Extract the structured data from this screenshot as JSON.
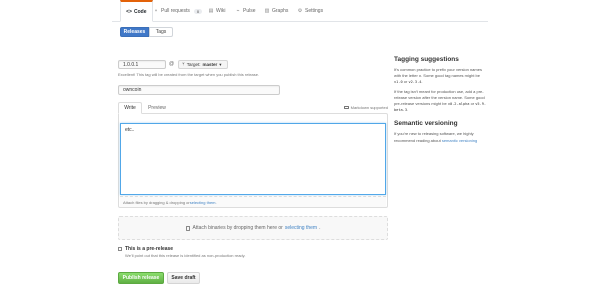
{
  "repo_nav": {
    "tabs": [
      {
        "label": "Code",
        "icon": "code-icon"
      },
      {
        "label": "Pull requests",
        "icon": "pull-request-icon",
        "count": "0"
      },
      {
        "label": "Wiki",
        "icon": "book-icon"
      },
      {
        "label": "Pulse",
        "icon": "pulse-icon"
      },
      {
        "label": "Graphs",
        "icon": "graph-icon"
      },
      {
        "label": "Settings",
        "icon": "gear-icon"
      }
    ]
  },
  "subnav": {
    "releases": "Releases",
    "tags": "Tags"
  },
  "form": {
    "tag_value": "1.0.0.1",
    "at": "@",
    "target_prefix": "Target:",
    "target_branch": "master",
    "tag_note": "Excellent! This tag will be created from the target when you publish this release.",
    "title_value": "owncoin",
    "tab_write": "Write",
    "tab_preview": "Preview",
    "markdown_hint": "Markdown supported",
    "body_value": "etc..",
    "attach_prefix": "Attach files by dragging & dropping or ",
    "attach_link": "selecting them",
    "attach_suffix": ".",
    "dropzone_prefix": "Attach binaries by dropping them here or ",
    "dropzone_link": "selecting them",
    "dropzone_suffix": ".",
    "prerelease_label": "This is a pre-release",
    "prerelease_note": "We'll point out that this release is identified as non-production ready.",
    "publish_label": "Publish release",
    "draft_label": "Save draft"
  },
  "sidebar": {
    "tagging_title": "Tagging suggestions",
    "tagging_p1_a": "It’s common practice to prefix your version names with the letter ",
    "tagging_p1_v": "v",
    "tagging_p1_b": ". Some good tag names might be ",
    "tagging_p1_e1": "v1.0",
    "tagging_p1_c": " or ",
    "tagging_p1_e2": "v2.3.4",
    "tagging_p1_d": ".",
    "tagging_p2_a": "If the tag isn’t meant for production use, add a pre-release version after the version name. Some good pre-release versions might be ",
    "tagging_p2_e1": "v0.2-alpha",
    "tagging_p2_c": " or ",
    "tagging_p2_e2": "v5.9-beta.3",
    "tagging_p2_d": ".",
    "semver_title": "Semantic versioning",
    "semver_p": "If you’re new to releasing software, we highly recommend reading about ",
    "semver_link": "semantic versioning"
  }
}
